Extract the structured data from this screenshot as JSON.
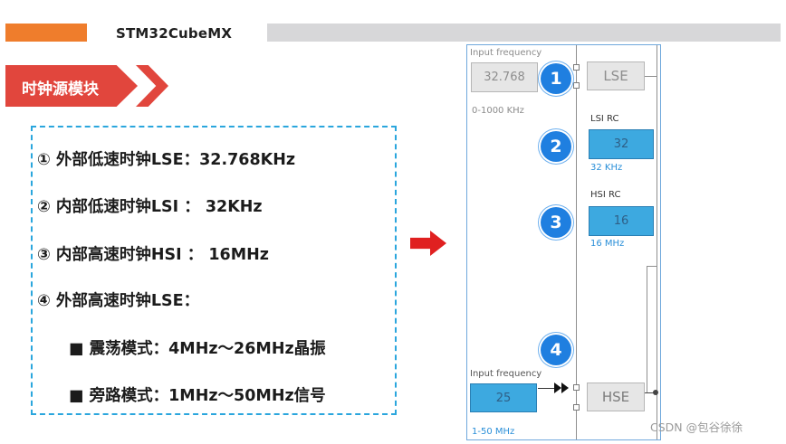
{
  "header": {
    "title": "STM32CubeMX"
  },
  "banner": {
    "title": "时钟源模块"
  },
  "content": {
    "lines": [
      "① 外部低速时钟LSE：32.768KHz",
      "② 内部低速时钟LSI ： 32KHz",
      "③ 内部高速时钟HSI ： 16MHz",
      "④ 外部高速时钟LSE：",
      "■ 震荡模式：4MHz～26MHz晶振",
      "■ 旁路模式：1MHz～50MHz信号"
    ]
  },
  "diagram": {
    "input_freq_top_label": "Input frequency",
    "input_freq_top_value": "32.768",
    "input_freq_top_range": "0-1000 KHz",
    "lse_label": "LSE",
    "lsi_title": "LSI RC",
    "lsi_value": "32",
    "lsi_unit": "32 KHz",
    "hsi_title": "HSI RC",
    "hsi_value": "16",
    "hsi_unit": "16 MHz",
    "input_freq_bottom_label": "Input frequency",
    "input_freq_bottom_value": "25",
    "input_freq_bottom_range": "1-50 MHz",
    "hse_label": "HSE",
    "badges": [
      "1",
      "2",
      "3",
      "4"
    ]
  },
  "watermark": "CSDN @包谷徐徐",
  "colors": {
    "accent_orange": "#ef7d2c",
    "banner_red": "#e1463d",
    "dashed_blue": "#2aa6dd",
    "badge_blue": "#1f7fe0",
    "field_blue": "#3da9e0"
  }
}
